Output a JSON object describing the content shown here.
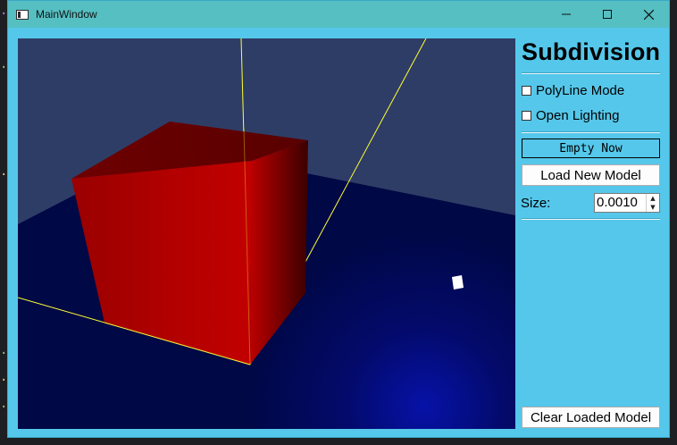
{
  "window": {
    "title": "MainWindow"
  },
  "panel": {
    "heading": "Subdivision",
    "polyline_label": "PolyLine Mode",
    "lighting_label": "Open Lighting",
    "polyline_checked": false,
    "lighting_checked": false,
    "status_text": "Empty Now",
    "load_button": "Load New Model",
    "size_label": "Size:",
    "size_value": "0.0010",
    "clear_button": "Clear Loaded Model"
  },
  "colors": {
    "window_bg": "#55c7ea",
    "titlebar": "#55bfc2",
    "sky": "#2e3d66",
    "ground": "#000a45",
    "cube": "#b00000",
    "axis": "#ffff33"
  },
  "icons": {
    "app": "window-icon",
    "minimize": "minimize-icon",
    "maximize": "maximize-icon",
    "close": "close-icon"
  }
}
